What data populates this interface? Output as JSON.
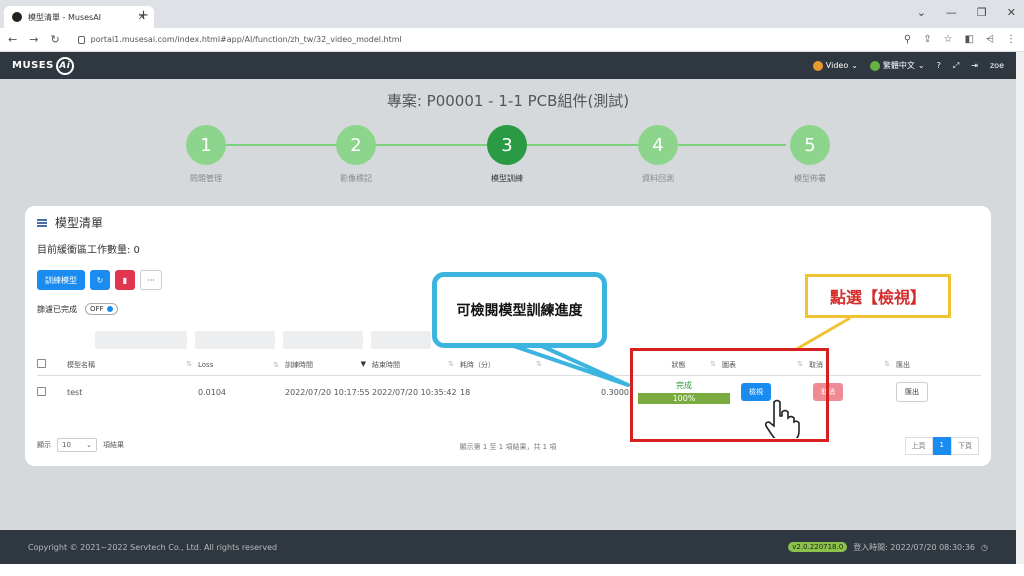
{
  "browser": {
    "tab_title": "模型清單 - MusesAI",
    "url": "portal1.musesai.com/index.html#app/AI/function/zh_tw/32_video_model.html"
  },
  "appbar": {
    "logo_text": "MUSES",
    "logo_ai": "Ai",
    "video_label": "Video",
    "lang_label": "繁體中文",
    "user": "zoe"
  },
  "project_title": "專案: P00001 - 1-1 PCB組件(測試)",
  "steps": [
    {
      "num": "1",
      "label": "問題管理"
    },
    {
      "num": "2",
      "label": "影像標記"
    },
    {
      "num": "3",
      "label": "模型訓練"
    },
    {
      "num": "4",
      "label": "資料回測"
    },
    {
      "num": "5",
      "label": "模型佈署"
    }
  ],
  "active_step": 3,
  "card": {
    "title": "模型清單",
    "queue_text": "目前緩衝區工作數量: 0",
    "train_button": "訓練模型",
    "more_button": "···",
    "filter_label": "篩濾已完成",
    "filter_state": "OFF"
  },
  "table": {
    "headers": [
      "模型名稱",
      "Loss",
      "訓練時間",
      "結束時間",
      "耗時（分）",
      "",
      "狀態",
      "圖表",
      "取消",
      "匯出"
    ],
    "row": {
      "name": "test",
      "loss": "0.0104",
      "train_time": "2022/07/20 10:17:55",
      "end_time": "2022/07/20 10:35:42",
      "duration": "18",
      "score": "0.3000",
      "status": "完成",
      "progress_text": "100%",
      "progress": 1.0,
      "view_button": "檢視",
      "cancel_button": "取消",
      "export_button": "匯出"
    }
  },
  "pagination": {
    "show_label": "顯示",
    "page_size": "10",
    "items_label": "項結果",
    "info": "顯示第 1 至 1 項結果，共 1 項",
    "prev": "上頁",
    "current": "1",
    "next": "下頁"
  },
  "annotations": {
    "bubble_text": "可檢閱模型訓練進度",
    "callout_text": "點選【檢視】"
  },
  "footer": {
    "copyright": "Copyright © 2021~2022 Servtech Co., Ltd. All rights reserved",
    "version": "v2.0.220718.0",
    "login_time": "登入時間: 2022/07/20 08:30:36"
  },
  "colors": {
    "active_step": "#2b9a44",
    "step": "#8dd58d",
    "primary": "#1a8cf0",
    "danger": "#e0344f",
    "annotation_red": "#d61f1f",
    "annotation_yellow": "#f1c232",
    "bubble_border": "#3bb4e0"
  }
}
